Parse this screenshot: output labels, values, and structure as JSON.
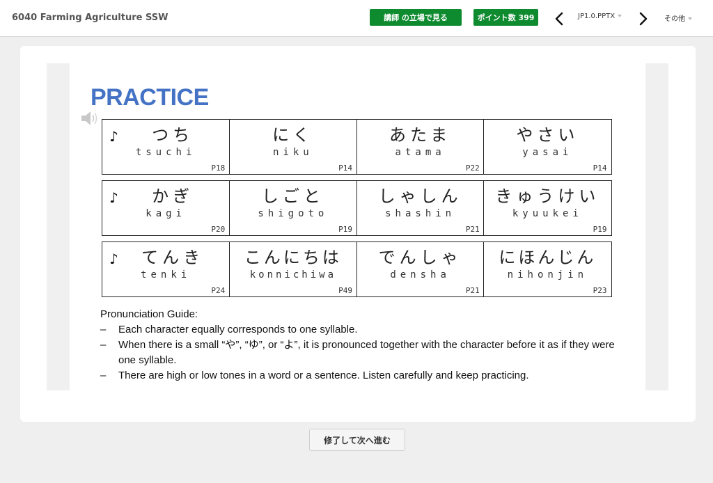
{
  "header": {
    "title": "6040 Farming Agriculture SSW",
    "instructor_view_label": "講師 の立場で見る",
    "points_label": "ポイント数 399",
    "file_name": "JP1.0.PPTX",
    "other_label": "その他",
    "accent_color": "#0e8a2f"
  },
  "slide": {
    "title": "PRACTICE",
    "title_color": "#4472c4",
    "rows": [
      [
        {
          "kana": "つち",
          "romaji": "tsuchi",
          "page": "P18"
        },
        {
          "kana": "にく",
          "romaji": "niku",
          "page": "P14"
        },
        {
          "kana": "あたま",
          "romaji": "atama",
          "page": "P22"
        },
        {
          "kana": "やさい",
          "romaji": "yasai",
          "page": "P14"
        }
      ],
      [
        {
          "kana": "かぎ",
          "romaji": "kagi",
          "page": "P20"
        },
        {
          "kana": "しごと",
          "romaji": "shigoto",
          "page": "P19"
        },
        {
          "kana": "しゃしん",
          "romaji": "shashin",
          "page": "P21"
        },
        {
          "kana": "きゅうけい",
          "romaji": "kyuukei",
          "page": "P19"
        }
      ],
      [
        {
          "kana": "てんき",
          "romaji": "tenki",
          "page": "P24"
        },
        {
          "kana": "こんにちは",
          "romaji": "konnichiwa",
          "page": "P49"
        },
        {
          "kana": "でんしゃ",
          "romaji": "densha",
          "page": "P21"
        },
        {
          "kana": "にほんじん",
          "romaji": "nihonjin",
          "page": "P23"
        }
      ]
    ],
    "guide_title": "Pronunciation Guide:",
    "guide_items": [
      "Each character equally corresponds to one syllable.",
      "When there is a small “や”, “ゆ”, or “よ”, it is pronounced together with the character before it as if they were one syllable.",
      "There are high or low tones in a word or a sentence. Listen carefully and keep practicing."
    ]
  },
  "footer": {
    "finish_label": "修了して次へ進む"
  },
  "icons": {
    "note": "♪",
    "speaker": "speaker-icon",
    "prev": "chevron-left-icon",
    "next": "chevron-right-icon"
  }
}
